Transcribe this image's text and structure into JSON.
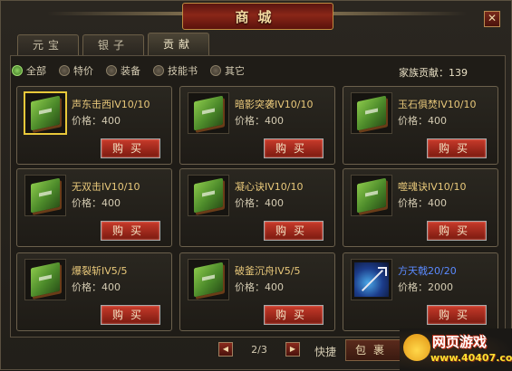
{
  "window": {
    "title": "商城",
    "close_label": "✕"
  },
  "tabs": [
    {
      "label": "元宝",
      "active": false
    },
    {
      "label": "银子",
      "active": false
    },
    {
      "label": "贡献",
      "active": true
    }
  ],
  "filters": [
    {
      "label": "全部",
      "selected": true
    },
    {
      "label": "特价",
      "selected": false
    },
    {
      "label": "装备",
      "selected": false
    },
    {
      "label": "技能书",
      "selected": false
    },
    {
      "label": "其它",
      "selected": false
    }
  ],
  "contribution": {
    "label": "家族贡献：",
    "value": "139"
  },
  "price_label": "价格：",
  "buy_label": "购买",
  "items": [
    {
      "name": "声东击西IV10/10",
      "price": "400",
      "icon": "green-book-icon"
    },
    {
      "name": "暗影突袭IV10/10",
      "price": "400",
      "icon": "green-book-icon"
    },
    {
      "name": "玉石俱焚IV10/10",
      "price": "400",
      "icon": "green-book-icon"
    },
    {
      "name": "无双击IV10/10",
      "price": "400",
      "icon": "green-book-icon"
    },
    {
      "name": "凝心诀IV10/10",
      "price": "400",
      "icon": "green-book-icon"
    },
    {
      "name": "噬魂诀IV10/10",
      "price": "400",
      "icon": "green-book-icon"
    },
    {
      "name": "爆裂斩IV5/5",
      "price": "400",
      "icon": "green-book-icon"
    },
    {
      "name": "破釜沉舟IV5/5",
      "price": "400",
      "icon": "green-book-icon"
    },
    {
      "name": "方天戟20/20",
      "price": "2000",
      "icon": "halberd-icon"
    }
  ],
  "pager": {
    "text": "2/3",
    "prev": "◀",
    "next": "▶"
  },
  "footer": {
    "quick_label": "快捷",
    "pack_label": "包裹"
  },
  "watermark": {
    "title": "网页游戏",
    "url": "www.40407.com"
  },
  "colors": {
    "item_name": "#e8c87a",
    "item_name_blue": "#5a8aff",
    "buy_button": "#b02a1c",
    "selected_border": "#e8c83a"
  }
}
